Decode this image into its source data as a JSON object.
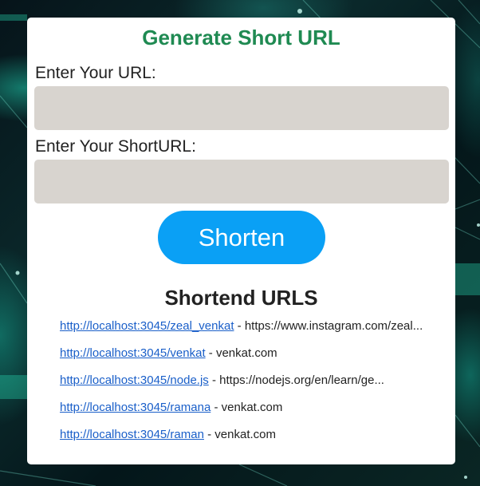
{
  "form": {
    "title": "Generate Short URL",
    "url_label": "Enter Your URL:",
    "url_value": "",
    "shorturl_label": "Enter Your ShortURL:",
    "shorturl_value": "",
    "shorten_label": "Shorten"
  },
  "list": {
    "heading": "Shortend URLS",
    "separator": " - ",
    "items": [
      {
        "short": "http://localhost:3045/zeal_venkat",
        "original": "https://www.instagram.com/zeal..."
      },
      {
        "short": "http://localhost:3045/venkat",
        "original": "venkat.com"
      },
      {
        "short": "http://localhost:3045/node.js",
        "original": "https://nodejs.org/en/learn/ge..."
      },
      {
        "short": "http://localhost:3045/ramana",
        "original": "venkat.com"
      },
      {
        "short": "http://localhost:3045/raman",
        "original": "venkat.com"
      }
    ]
  },
  "colors": {
    "title": "#1f8a52",
    "button": "#0aa0f5",
    "link": "#1a5fc9",
    "field": "#d8d4cf"
  }
}
